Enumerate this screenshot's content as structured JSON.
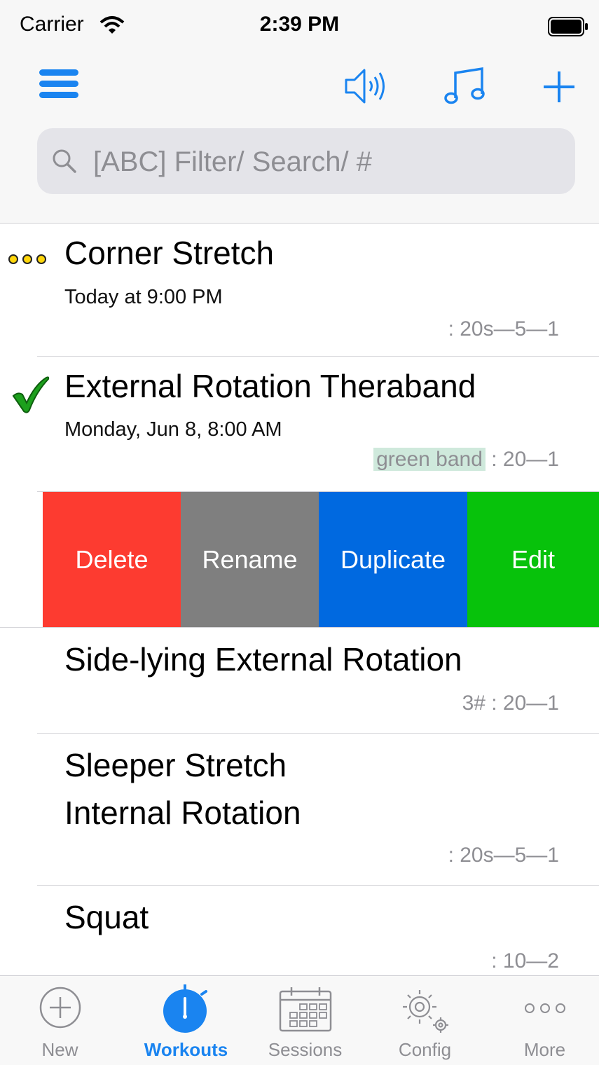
{
  "status_bar": {
    "carrier": "Carrier",
    "time": "2:39 PM"
  },
  "nav": {
    "menu_icon": "hamburger-icon",
    "speaker_icon": "speaker-icon",
    "music_icon": "music-note-icon",
    "add_icon": "plus-icon",
    "accent_color": "#1a84f0"
  },
  "search": {
    "placeholder": "[ABC] Filter/ Search/ #"
  },
  "rows": [
    {
      "title": "Corner Stretch",
      "subtitle": "Today at 9:00 PM",
      "meta": ": 20s—5—1",
      "status_icon": "ellipsis-yellow-icon"
    },
    {
      "title": "External Rotation Theraband",
      "subtitle": "Monday, Jun 8, 8:00 AM",
      "tag": "green band",
      "meta": ": 20—1",
      "status_icon": "checkmark-green-icon"
    },
    {
      "title": "Side-lying External Rotation",
      "meta": "3# : 20—1"
    },
    {
      "title_line1": "Sleeper Stretch",
      "title_line2": "Internal Rotation",
      "meta": ": 20s—5—1"
    },
    {
      "title": "Squat",
      "meta": ": 10—2"
    }
  ],
  "swipe_actions": [
    {
      "label": "Delete",
      "color": "#fd3b30"
    },
    {
      "label": "Rename",
      "color": "#7f7f7f"
    },
    {
      "label": "Duplicate",
      "color": "#0069e0"
    },
    {
      "label": "Edit",
      "color": "#07c20b"
    }
  ],
  "tabs": [
    {
      "label": "New",
      "icon": "plus-circle-icon"
    },
    {
      "label": "Workouts",
      "icon": "stopwatch-icon",
      "active": true
    },
    {
      "label": "Sessions",
      "icon": "calendar-icon"
    },
    {
      "label": "Config",
      "icon": "gears-icon"
    },
    {
      "label": "More",
      "icon": "more-dots-icon"
    }
  ]
}
